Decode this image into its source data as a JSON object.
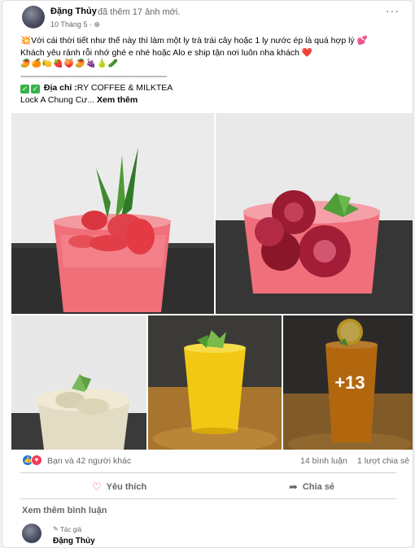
{
  "post": {
    "author": "Đặng Thủy",
    "action": "đã thêm 17 ảnh mới.",
    "date": "10 Tháng 5",
    "dot": "·",
    "privacy_icon": "globe-icon",
    "more": "···",
    "lines": [
      "💥Với cái thời tiết như thế này thì làm một ly trà trái cây hoặc 1 ly nước ép là quá hợp lý 💕",
      "Khách yêu rảnh rỗi nhớ ghé e nhé hoặc Alo e ship tận nơi luôn nha khách ❤️",
      "🥭🍊🍋🍓🍑🥭🍇🍐🥒",
      "------------------------------------------------------------"
    ],
    "address_label": "Địa chỉ :",
    "address_value": "RY COFFEE & MILKTEA",
    "address_rest": "Lock A Chung Cư...",
    "see_more": "Xem thêm"
  },
  "photos": {
    "more_count": "+13"
  },
  "stats": {
    "reactions": "Bạn và 42 người khác",
    "comments": "14 bình luận",
    "shares": "1 lượt chia sẻ"
  },
  "actions": {
    "like": "Yêu thích",
    "share": "Chia sẻ"
  },
  "comments_section": {
    "view_more": "Xem thêm bình luận",
    "badge": "Tác giả",
    "name": "Đặng Thủy"
  },
  "colors": {
    "like_blue": "#1877f2",
    "love_red": "#f33e58",
    "check_green": "#36b34a"
  }
}
